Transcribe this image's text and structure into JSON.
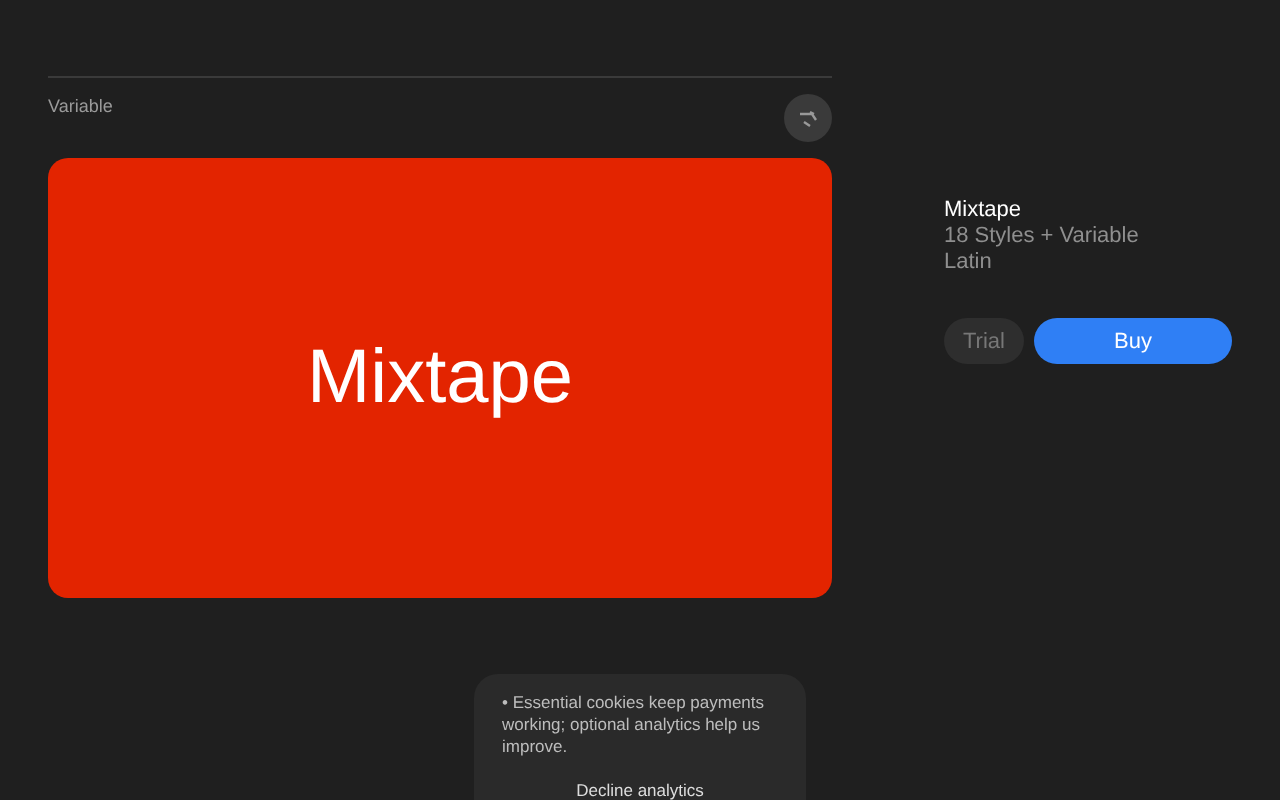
{
  "preview": {
    "label": "Variable",
    "sample_text": "Mixtape"
  },
  "product": {
    "name": "Mixtape",
    "styles": "18 Styles + Variable",
    "script": "Latin"
  },
  "buttons": [
    {
      "kind": "secondary",
      "label": "Trial"
    },
    {
      "kind": "primary",
      "label": "Buy"
    }
  ],
  "cookie_notice": {
    "message": "• Essential cookies keep payments working; optional analytics help us improve.",
    "action": "Decline analytics"
  }
}
